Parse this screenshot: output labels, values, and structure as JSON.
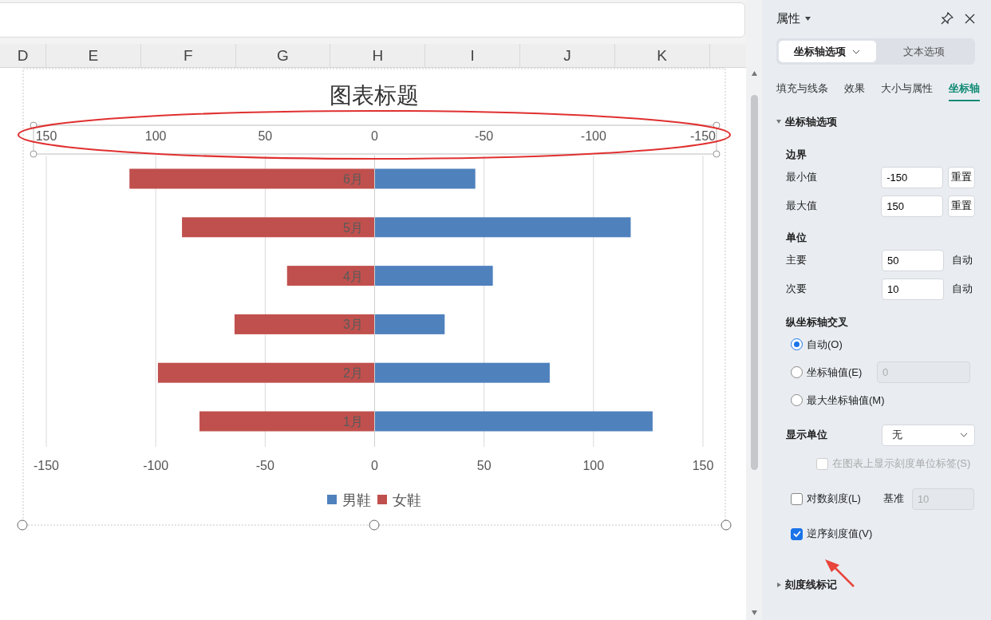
{
  "sheet": {
    "columns": [
      "D",
      "E",
      "F",
      "G",
      "H",
      "I",
      "J",
      "K"
    ],
    "chart": {
      "title": "图表标题",
      "top_axis_labels": [
        "150",
        "100",
        "50",
        "0",
        "-50",
        "-100",
        "-150"
      ],
      "chart_data": {
        "type": "bar",
        "orientation": "horizontal",
        "stacked": true,
        "grid": true,
        "legend": true,
        "categories": [
          "6月",
          "5月",
          "4月",
          "3月",
          "2月",
          "1月"
        ],
        "series": [
          {
            "name": "男鞋",
            "color": "#4f81bd",
            "values": [
              46,
              117,
              54,
              32,
              80,
              127
            ]
          },
          {
            "name": "女鞋",
            "color": "#c0504d",
            "values": [
              -112,
              -88,
              -40,
              -64,
              -99,
              -80
            ]
          }
        ],
        "xlim": [
          -150,
          150
        ],
        "xticks": [
          {
            "value": -150,
            "label": "-150"
          },
          {
            "value": -100,
            "label": "-100"
          },
          {
            "value": -50,
            "label": "-50"
          },
          {
            "value": 0,
            "label": "0"
          },
          {
            "value": 50,
            "label": "50"
          },
          {
            "value": 100,
            "label": "100"
          },
          {
            "value": 150,
            "label": "150"
          }
        ]
      }
    }
  },
  "panel": {
    "title": "属性",
    "segments": [
      {
        "label": "坐标轴选项",
        "selected": true
      },
      {
        "label": "文本选项",
        "selected": false
      }
    ],
    "tabs": [
      {
        "label": "填充与线条",
        "selected": false
      },
      {
        "label": "效果",
        "selected": false
      },
      {
        "label": "大小与属性",
        "selected": false
      },
      {
        "label": "坐标轴",
        "selected": true
      }
    ],
    "axis_options": {
      "title": "坐标轴选项",
      "expanded": true,
      "bounds": {
        "heading": "边界",
        "rows": [
          {
            "label": "最小值",
            "value": "-150",
            "button": "重置"
          },
          {
            "label": "最大值",
            "value": "150",
            "button": "重置"
          }
        ]
      },
      "units": {
        "heading": "单位",
        "rows": [
          {
            "label": "主要",
            "value": "50",
            "suffix": "自动"
          },
          {
            "label": "次要",
            "value": "10",
            "suffix": "自动"
          }
        ]
      },
      "cross": {
        "heading": "纵坐标轴交叉",
        "options": [
          {
            "label": "自动(O)",
            "selected": true
          },
          {
            "label": "坐标轴值(E)",
            "selected": false,
            "field": "0"
          },
          {
            "label": "最大坐标轴值(M)",
            "selected": false
          }
        ]
      },
      "display_unit": {
        "label": "显示单位",
        "value": "无"
      },
      "checkboxes": [
        {
          "label": "在图表上显示刻度单位标签(S)",
          "checked": false,
          "disabled": true
        },
        {
          "label": "对数刻度(L)",
          "checked": false,
          "disabled": false,
          "extra_label": "基准",
          "extra_value": "10"
        },
        {
          "label": "逆序刻度值(V)",
          "checked": true,
          "disabled": false
        }
      ]
    },
    "tick_marks": {
      "title": "刻度线标记",
      "expanded": false
    }
  }
}
